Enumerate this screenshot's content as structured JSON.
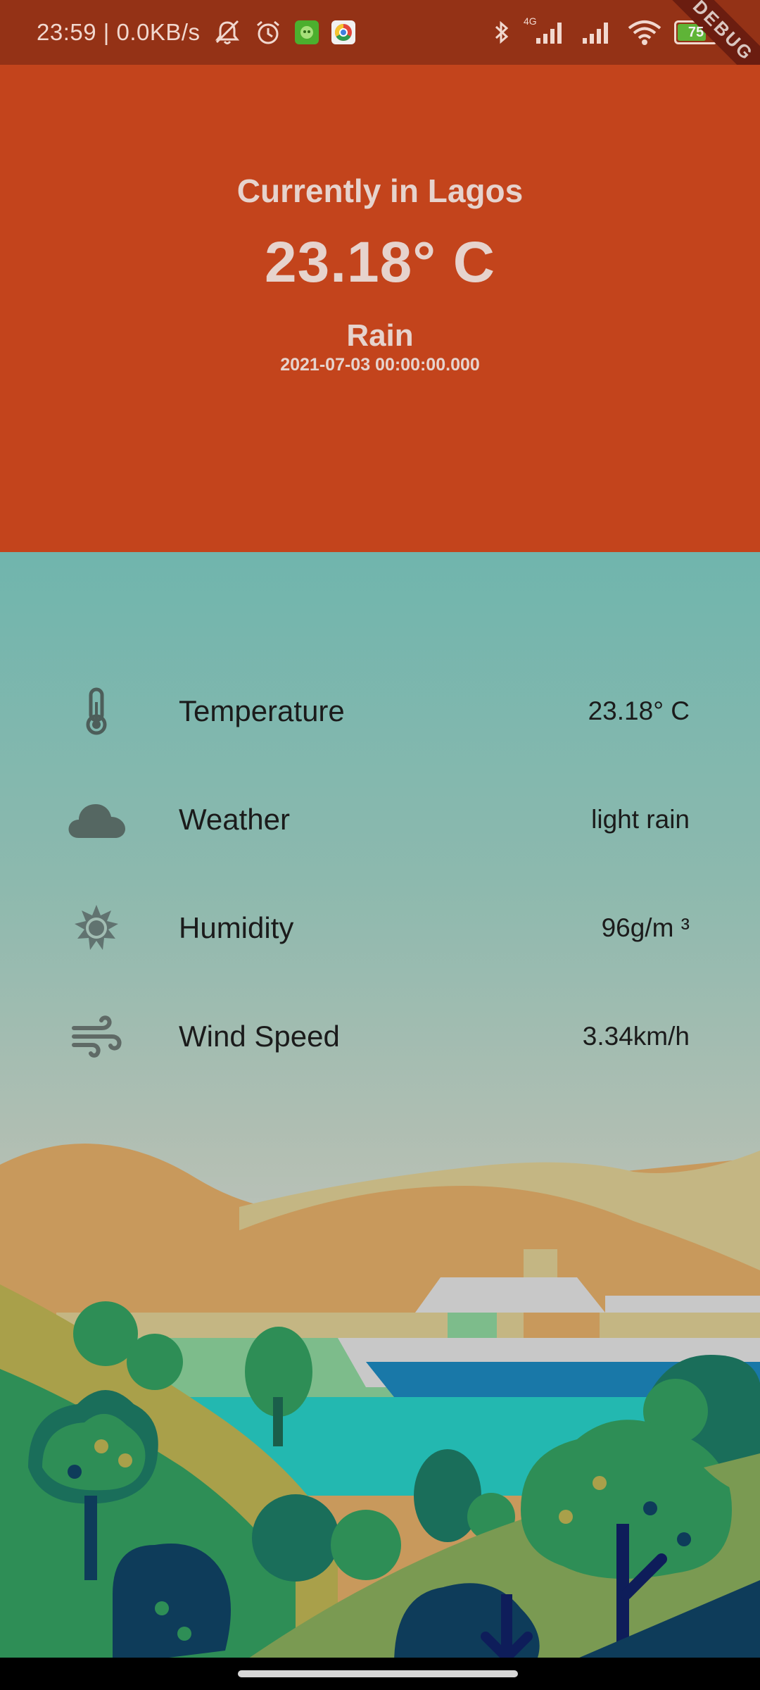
{
  "status_bar": {
    "time_speed": "23:59 | 0.0KB/s",
    "network_label": "4G",
    "battery_level": "75",
    "icons": [
      "mute-icon",
      "alarm-icon",
      "app-icon",
      "chrome-icon",
      "bluetooth-icon",
      "signal-icon",
      "signal-icon",
      "wifi-icon",
      "battery-icon"
    ]
  },
  "debug_ribbon": "DEBUG",
  "header": {
    "location": "Currently in Lagos",
    "temperature": "23.18° C",
    "condition": "Rain",
    "datetime": "2021-07-03 00:00:00.000"
  },
  "details": [
    {
      "label": "Temperature",
      "value": "23.18° C",
      "icon": "thermometer-icon"
    },
    {
      "label": "Weather",
      "value": "light rain",
      "icon": "cloud-icon"
    },
    {
      "label": "Humidity",
      "value": "96g/m ³",
      "icon": "sun-icon"
    },
    {
      "label": "Wind Speed",
      "value": "3.34km/h",
      "icon": "wind-icon"
    }
  ],
  "colors": {
    "header_bg": "#c3441c",
    "status_bg": "#943216",
    "lower_top": "#70b5ad",
    "lower_bottom": "#c8c8c8"
  }
}
